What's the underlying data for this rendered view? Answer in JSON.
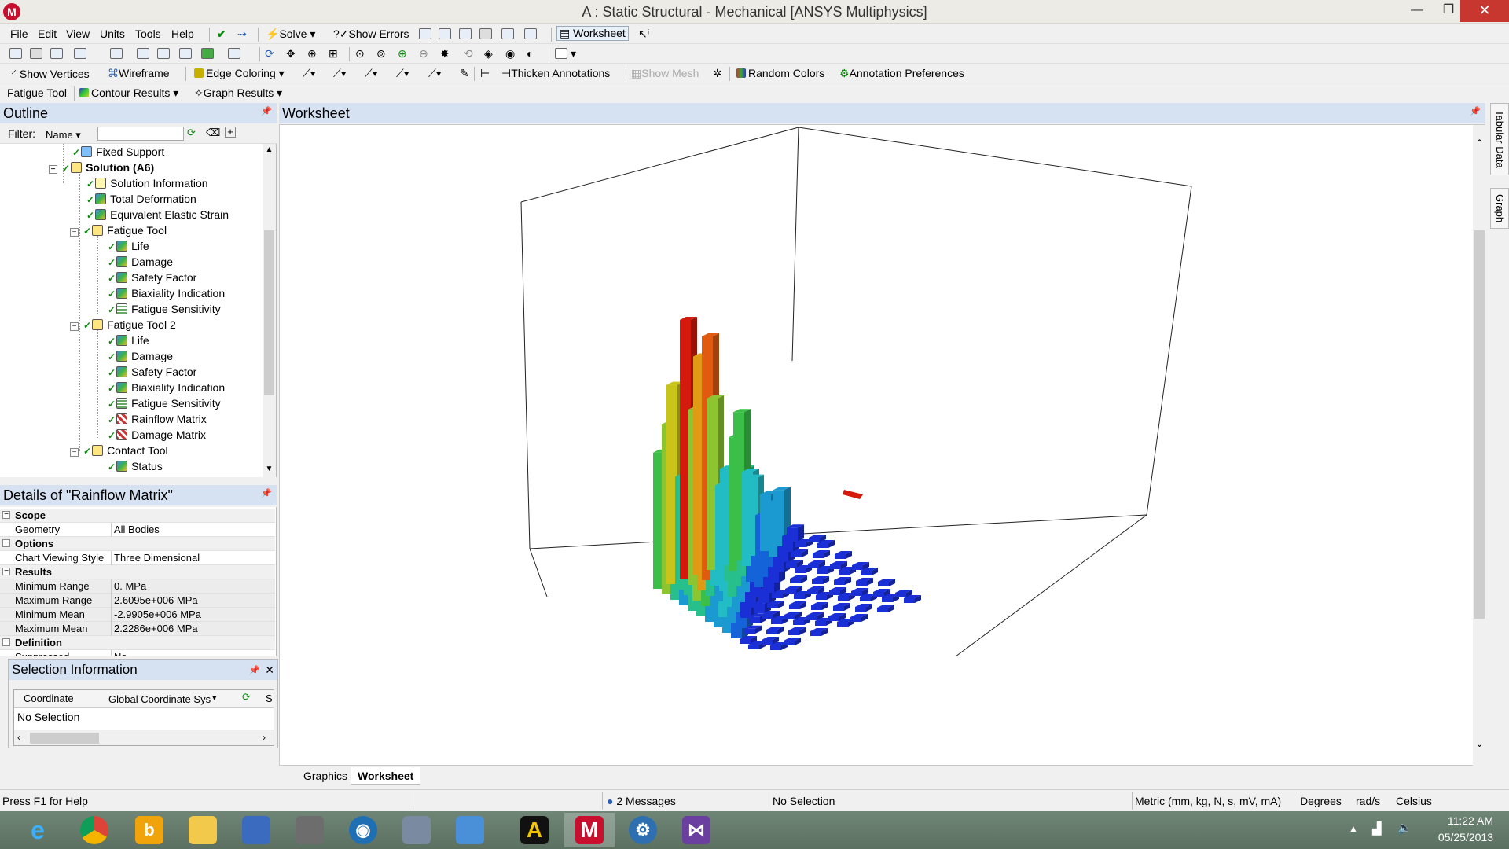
{
  "window": {
    "title": "A : Static Structural - Mechanical [ANSYS Multiphysics]",
    "app_icon_letter": "M",
    "minimize": "—",
    "maximize": "❐",
    "close": "✕"
  },
  "menu": [
    "File",
    "Edit",
    "View",
    "Units",
    "Tools",
    "Help"
  ],
  "toolbar1": {
    "solve": "Solve",
    "show_errors": "Show Errors",
    "worksheet": "Worksheet"
  },
  "toolbar3": {
    "show_vertices": "Show Vertices",
    "wireframe": "Wireframe",
    "edge_coloring": "Edge Coloring",
    "thicken_annotations": "Thicken Annotations",
    "show_mesh": "Show Mesh",
    "random_colors": "Random Colors",
    "annotation_preferences": "Annotation Preferences"
  },
  "context_toolbar": {
    "fatigue_tool": "Fatigue Tool",
    "contour_results": "Contour Results",
    "graph_results": "Graph Results"
  },
  "outline": {
    "title": "Outline",
    "filter_label": "Filter:",
    "filter_value": "Name",
    "items": [
      {
        "label": "Fixed Support"
      },
      {
        "label": "Solution (A6)"
      },
      {
        "label": "Solution Information"
      },
      {
        "label": "Total Deformation"
      },
      {
        "label": "Equivalent Elastic Strain"
      },
      {
        "label": "Fatigue Tool"
      },
      {
        "label": "Life"
      },
      {
        "label": "Damage"
      },
      {
        "label": "Safety Factor"
      },
      {
        "label": "Biaxiality Indication"
      },
      {
        "label": "Fatigue Sensitivity"
      },
      {
        "label": "Fatigue Tool 2"
      },
      {
        "label": "Life"
      },
      {
        "label": "Damage"
      },
      {
        "label": "Safety Factor"
      },
      {
        "label": "Biaxiality Indication"
      },
      {
        "label": "Fatigue Sensitivity"
      },
      {
        "label": "Rainflow Matrix"
      },
      {
        "label": "Damage Matrix"
      },
      {
        "label": "Contact Tool"
      },
      {
        "label": "Status"
      }
    ]
  },
  "details": {
    "title": "Details of \"Rainflow Matrix\"",
    "rows": [
      {
        "key": "Scope",
        "value": "",
        "group": true
      },
      {
        "key": "Geometry",
        "value": "All Bodies"
      },
      {
        "key": "Options",
        "value": "",
        "group": true
      },
      {
        "key": "Chart Viewing Style",
        "value": "Three Dimensional"
      },
      {
        "key": "Results",
        "value": "",
        "group": true
      },
      {
        "key": "Minimum Range",
        "value": "0. MPa"
      },
      {
        "key": "Maximum Range",
        "value": "2.6095e+006 MPa"
      },
      {
        "key": "Minimum Mean",
        "value": "-2.9905e+006 MPa"
      },
      {
        "key": "Maximum Mean",
        "value": "2.2286e+006 MPa"
      },
      {
        "key": "Definition",
        "value": "",
        "group": true
      },
      {
        "key": "Suppressed",
        "value": "No"
      }
    ]
  },
  "selection_info": {
    "title": "Selection Information",
    "coordinate_label": "Coordinate",
    "coordinate_value": "Global Coordinate Sys",
    "s_col": "S",
    "no_selection": "No Selection"
  },
  "worksheet": {
    "title": "Worksheet",
    "tab_graphics": "Graphics",
    "tab_worksheet": "Worksheet"
  },
  "right_tabs": [
    "Tabular Data",
    "Graph"
  ],
  "status": {
    "help": "Press F1 for Help",
    "messages": "2 Messages",
    "selection": "No Selection",
    "units": "Metric (mm, kg, N, s, mV, mA)",
    "angle": "Degrees",
    "rot": "rad/s",
    "temp": "Celsius"
  },
  "taskbar": {
    "apps": [
      "internet-explorer",
      "chrome",
      "bing",
      "file-explorer",
      "network",
      "calculator",
      "media-player",
      "ssh",
      "mobile",
      "autocad",
      "mcafee",
      "ansys-workbench",
      "visual-studio"
    ],
    "time": "11:22 AM",
    "date": "05/25/2013"
  },
  "colors": {
    "panel_header": "#d6e2f2",
    "title_close": "#c7372f",
    "taskbar": "#5b7060"
  }
}
